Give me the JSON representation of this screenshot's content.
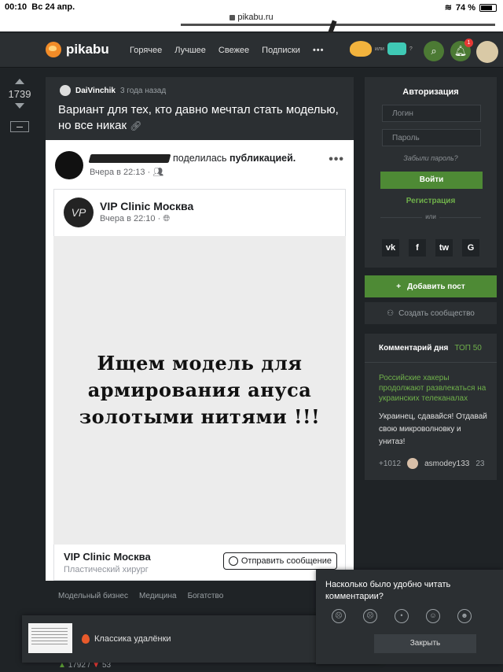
{
  "status_bar": {
    "time": "00:10",
    "date": "Вс 24 апр.",
    "battery": "74 %",
    "url": "pikabu.ru"
  },
  "header": {
    "logo": "pikabu",
    "nav": [
      "Горячее",
      "Лучшее",
      "Свежее",
      "Подписки"
    ],
    "nav_more": "•••",
    "toggle_or": "или",
    "toggle_q": "?",
    "notification_count": "1"
  },
  "rating": {
    "value": "1739"
  },
  "story": {
    "author": "DaiVinchik",
    "time": "3 года назад",
    "title": "Вариант для тех, кто давно мечтал стать моделью, но все никак",
    "link_icon": "link-icon"
  },
  "fb_post": {
    "shared_text": "поделилась",
    "shared_bold": "публикацией.",
    "time": "Вчера в 22:13 ·",
    "more": "•••",
    "page_name": "VIP Clinic Москва",
    "page_time": "Вчера в 22:10 ·",
    "avatar_text": "VP",
    "image_lines": [
      "Ищем модель для",
      "армирования ануса",
      "золотыми нитями !!!"
    ],
    "footer_name": "VIP Clinic Москва",
    "footer_category": "Пластический хирург",
    "message_button": "Отправить сообщение"
  },
  "tags": [
    "Модельный бизнес",
    "Медицина",
    "Богатство"
  ],
  "bottom_rating": {
    "up": "1792",
    "down": "53"
  },
  "auth": {
    "title": "Авторизация",
    "login_placeholder": "Логин",
    "password_placeholder": "Пароль",
    "forgot": "Забыли пароль?",
    "login_button": "Войти",
    "register": "Регистрация",
    "or": "или",
    "socials": [
      "vk",
      "f",
      "tw",
      "G"
    ]
  },
  "sidebar": {
    "add_post": "Добавить пост",
    "create_community": "Создать сообщество"
  },
  "comment_of_day": {
    "title": "Комментарий дня",
    "top": "ТОП 50",
    "link": "Российские хакеры продолжают развлекаться на украинских телеканалах",
    "text": "Украинец, сдавайся! Отдавай свою микроволновку и унитаз!",
    "score": "+1012",
    "user": "asmodey133",
    "time": "23"
  },
  "notification": {
    "text": "Классика удалёнки",
    "close": "✕"
  },
  "feedback": {
    "question": "Насколько было удобно читать комментарии?",
    "close": "Закрыть"
  }
}
